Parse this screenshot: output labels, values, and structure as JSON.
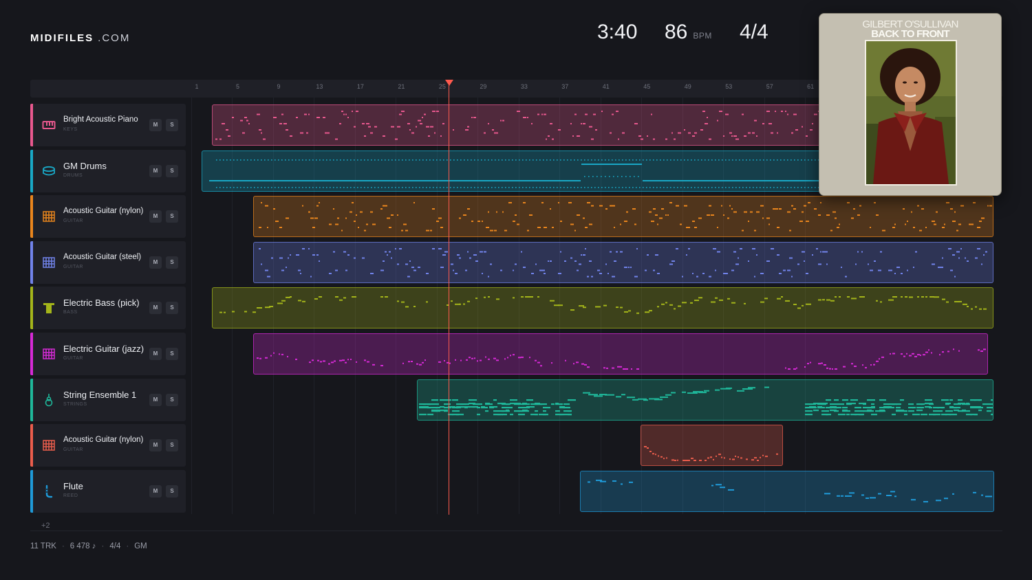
{
  "brand": {
    "name": "MIDIFILES",
    "suffix": ".COM"
  },
  "transport": {
    "time": "3:40",
    "tempo": "86",
    "tempo_unit": "BPM",
    "time_signature": "4/4"
  },
  "ruler": {
    "ticks": [
      "1",
      "5",
      "9",
      "13",
      "17",
      "21",
      "25",
      "29",
      "33",
      "37",
      "41",
      "45",
      "49",
      "53",
      "57",
      "61"
    ]
  },
  "playhead": {
    "bar": 25
  },
  "mute_label": "M",
  "solo_label": "S",
  "tracks": [
    {
      "name": "Bright Acoustic Piano",
      "category": "KEYS",
      "color": "#e8588e",
      "icon": "piano-icon"
    },
    {
      "name": "GM Drums",
      "category": "DRUMS",
      "color": "#19a8c6",
      "icon": "drum-icon"
    },
    {
      "name": "Acoustic Guitar (nylon)",
      "category": "GUITAR",
      "color": "#e9851d",
      "icon": "guitar-icon"
    },
    {
      "name": "Acoustic Guitar (steel)",
      "category": "GUITAR",
      "color": "#7183ea",
      "icon": "guitar-icon"
    },
    {
      "name": "Electric Bass (pick)",
      "category": "BASS",
      "color": "#a4b51a",
      "icon": "bass-icon"
    },
    {
      "name": "Electric Guitar (jazz)",
      "category": "GUITAR",
      "color": "#d62ad6",
      "icon": "guitar-icon"
    },
    {
      "name": "String Ensemble 1",
      "category": "STRINGS",
      "color": "#1fb79a",
      "icon": "violin-icon"
    },
    {
      "name": "Acoustic Guitar (nylon)",
      "category": "GUITAR",
      "color": "#ea5d4c",
      "icon": "guitar-icon"
    },
    {
      "name": "Flute",
      "category": "REED",
      "color": "#1f9ad8",
      "icon": "flute-icon"
    }
  ],
  "more_tracks": "+2",
  "footer": {
    "tracks": "11 TRK",
    "notes": "6 478 ♪",
    "time_signature": "4/4",
    "standard": "GM"
  },
  "album": {
    "artist": "GILBERT O'SULLIVAN",
    "title": "BACK TO FRONT"
  }
}
